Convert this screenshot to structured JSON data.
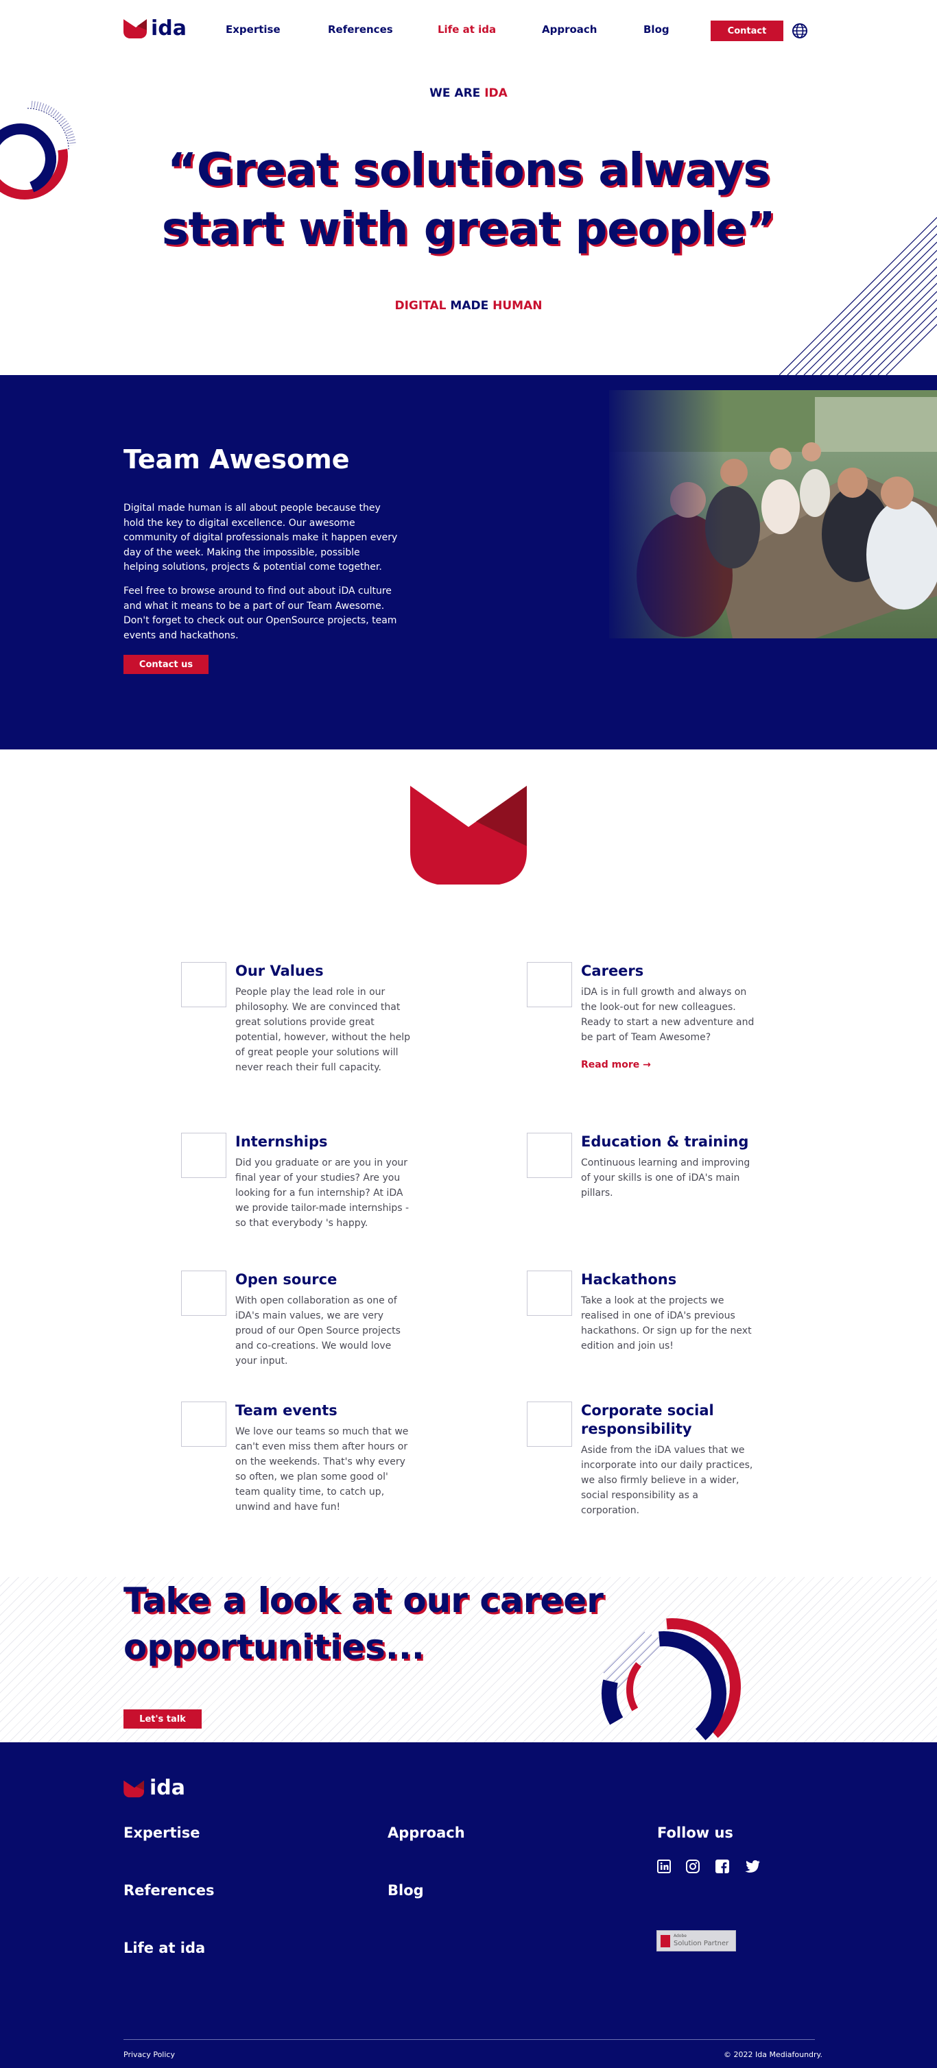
{
  "brand": {
    "logo_text": "ida",
    "primary_color": "#060b6b",
    "accent_color": "#c8102e"
  },
  "nav": {
    "items": [
      "Expertise",
      "References",
      "Life at ida",
      "Approach",
      "Blog"
    ],
    "active": "Life at ida",
    "contact_label": "Contact",
    "language_icon": "globe-icon"
  },
  "hero": {
    "eyebrow_a": "WE ARE",
    "eyebrow_b": "IDA",
    "title": "“Great solutions always start with great people”",
    "tagline_a": "DIGITAL",
    "tagline_b": "MADE",
    "tagline_c": "HUMAN"
  },
  "team": {
    "title": "Team Awesome",
    "p1": "Digital made human is all about people because they hold the key to digital excellence. Our awesome community of digital professionals make it happen every day of the week. Making the impossible, possible helping solutions, projects & potential come together.",
    "p2": "Feel free to browse around to find out about iDA culture and what it means to be a part of our Team Awesome. Don't forget to check out our OpenSource projects, team events and hackathons.",
    "button": "Contact us"
  },
  "features": [
    {
      "title": "Our Values",
      "text": "People play the lead role in our philosophy. We are convinced that great solutions provide great potential, however, without the help of great people your solutions will never reach their full capacity.",
      "link": ""
    },
    {
      "title": "Careers",
      "text": "iDA is in full growth and always on the look-out for new colleagues. Ready to start a new adventure and be part of Team Awesome?",
      "link": "Read more →"
    },
    {
      "title": "Internships",
      "text": "Did you graduate or are you in your final year of your studies? Are you looking for a fun internship? At iDA we provide tailor-made internships - so that everybody 's happy.",
      "link": ""
    },
    {
      "title": "Education & training",
      "text": "Continuous learning and improving of your skills is one of iDA's main pillars.",
      "link": ""
    },
    {
      "title": "Open source",
      "text": "With open collaboration as one of iDA's main values, we are very proud of our Open Source projects and co-creations. We would love your input.",
      "link": ""
    },
    {
      "title": "Hackathons",
      "text": "Take a look at the projects we realised in one of iDA's previous hackathons. Or sign up for the next edition and join us!",
      "link": ""
    },
    {
      "title": "Team events",
      "text": "We love our teams so much that we can't even miss them after hours or on the weekends. That's why every so often, we plan some good ol' team quality time, to catch up, unwind and have fun!",
      "link": ""
    },
    {
      "title": "Corporate social responsibility",
      "text": "Aside from the iDA values that we incorporate into our daily practices, we also firmly believe in a wider, social responsibility as a corporation.",
      "link": ""
    }
  ],
  "cta": {
    "title": "Take a look at our career opportunities...",
    "button": "Let's talk"
  },
  "footer": {
    "col1": [
      "Expertise",
      "References",
      "Life at ida"
    ],
    "col2": [
      "Approach",
      "Blog"
    ],
    "follow_title": "Follow us",
    "social_icons": [
      "linkedin-icon",
      "instagram-icon",
      "facebook-icon",
      "twitter-icon"
    ],
    "badge_line1": "Adobe",
    "badge_line2": "Solution Partner",
    "privacy": "Privacy Policy",
    "copyright": "© 2022 Ida Mediafoundry."
  }
}
